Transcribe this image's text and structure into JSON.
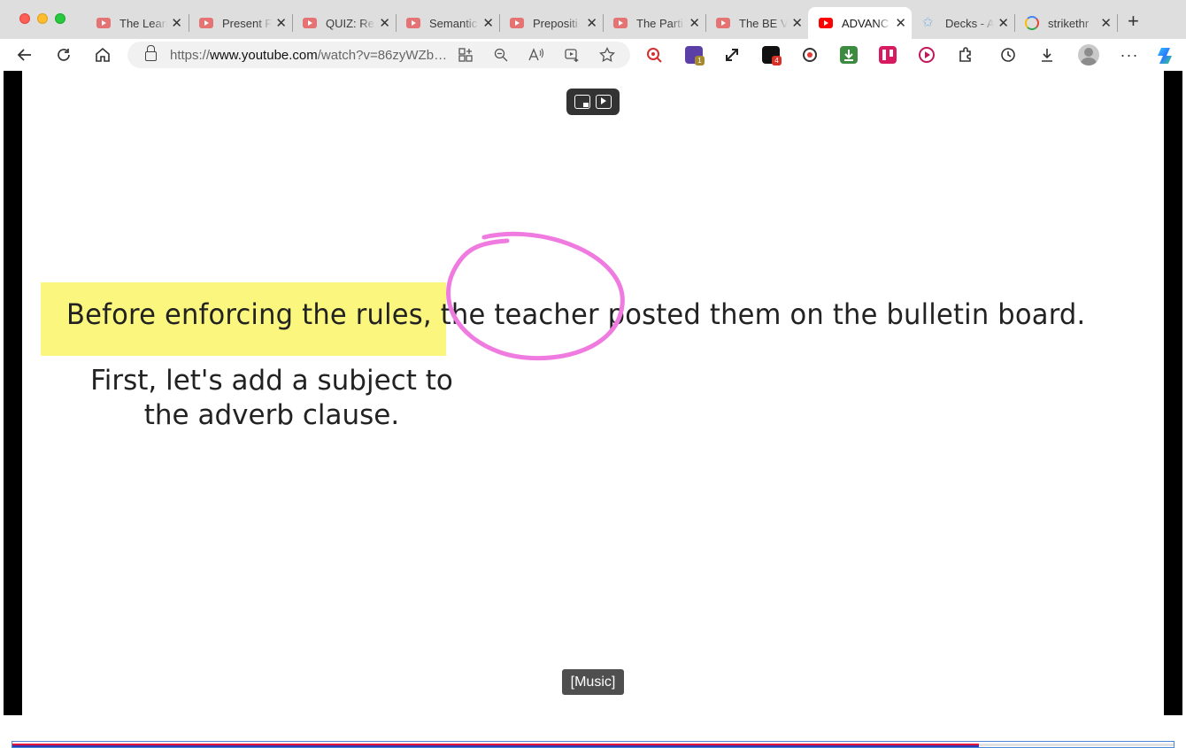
{
  "tabs": [
    {
      "title": "The Learn",
      "icon": "youtube-icon"
    },
    {
      "title": "Present P",
      "icon": "youtube-icon"
    },
    {
      "title": "QUIZ: Re",
      "icon": "youtube-icon"
    },
    {
      "title": "Semantic",
      "icon": "youtube-icon"
    },
    {
      "title": "Prepositi",
      "icon": "youtube-icon"
    },
    {
      "title": "The Parti",
      "icon": "youtube-icon"
    },
    {
      "title": "The BE V",
      "icon": "youtube-icon"
    },
    {
      "title": "ADVANC",
      "icon": "youtube-icon",
      "active": true
    },
    {
      "title": "Decks - A",
      "icon": "decks-icon"
    },
    {
      "title": "strikethr",
      "icon": "google-icon"
    }
  ],
  "toolbar": {
    "url_prefix": "https://",
    "url_host": "www.youtube.com",
    "url_path": "/watch?v=86zyWZb…",
    "extension_badges": {
      "ext2": "1",
      "ext4": "4"
    }
  },
  "video": {
    "sentence_highlighted": "Before enforcing the rules,",
    "sentence_circled": "the teacher",
    "sentence_rest": "posted them on the bulletin board.",
    "instruction_line1": "First, let's add a subject to",
    "instruction_line2": "the adverb clause.",
    "caption": "[Music]",
    "progress": 0.832,
    "highlight_color": "#fbf67e",
    "circle_color": "#f07be0",
    "progress_color": "#e5143c"
  }
}
